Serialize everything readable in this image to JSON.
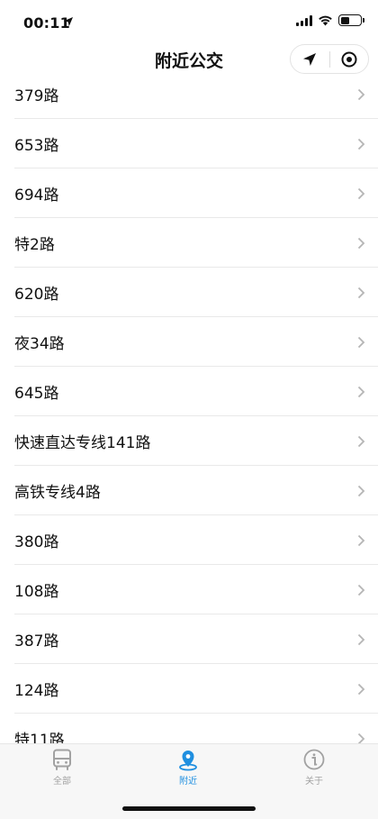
{
  "status_bar": {
    "time": "00:11",
    "icons": [
      "location-arrow-icon",
      "signal-icon",
      "wifi-icon",
      "battery-icon"
    ]
  },
  "nav": {
    "title": "附近公交",
    "icons": [
      "navigation-arrow-icon",
      "target-icon"
    ]
  },
  "routes": [
    {
      "label": "379路"
    },
    {
      "label": "653路"
    },
    {
      "label": "694路"
    },
    {
      "label": "特2路"
    },
    {
      "label": "620路"
    },
    {
      "label": "夜34路"
    },
    {
      "label": "645路"
    },
    {
      "label": "快速直达专线141路"
    },
    {
      "label": "高铁专线4路"
    },
    {
      "label": "380路"
    },
    {
      "label": "108路"
    },
    {
      "label": "387路"
    },
    {
      "label": "124路"
    },
    {
      "label": "特11路"
    }
  ],
  "tabs": [
    {
      "label": "全部",
      "icon": "bus-icon",
      "active": false
    },
    {
      "label": "附近",
      "icon": "location-pin-icon",
      "active": true
    },
    {
      "label": "关于",
      "icon": "info-icon",
      "active": false
    }
  ],
  "colors": {
    "accent": "#1f8fe0",
    "inactive": "#a2a2a2",
    "divider": "#e9e9e9",
    "tabbar_bg": "#f7f7f7"
  }
}
